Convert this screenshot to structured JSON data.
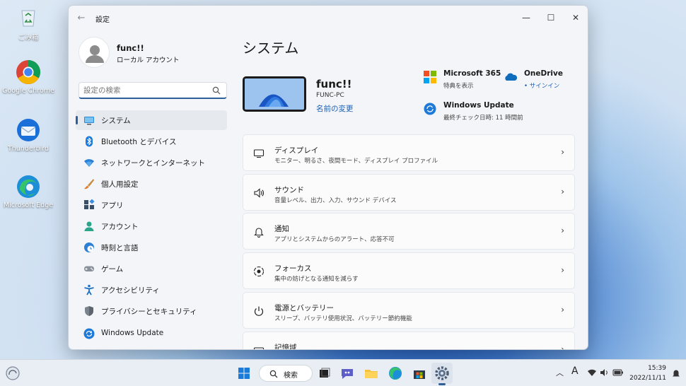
{
  "desktop": {
    "icons": [
      {
        "label": "ごみ箱",
        "icon": "recycle-bin-icon"
      },
      {
        "label": "Google Chrome",
        "icon": "chrome-icon"
      },
      {
        "label": "Thunderbird",
        "icon": "thunderbird-icon"
      },
      {
        "label": "Microsoft Edge",
        "icon": "edge-icon"
      }
    ]
  },
  "window": {
    "title": "設定",
    "controls": {
      "minimize": "—",
      "maximize": "☐",
      "close": "✕"
    }
  },
  "profile": {
    "name": "func!!",
    "account_type": "ローカル アカウント"
  },
  "search": {
    "placeholder": "設定の検索",
    "value": ""
  },
  "nav": {
    "items": [
      {
        "label": "システム",
        "icon": "monitor-icon",
        "active": true
      },
      {
        "label": "Bluetooth とデバイス",
        "icon": "bluetooth-icon"
      },
      {
        "label": "ネットワークとインターネット",
        "icon": "wifi-icon"
      },
      {
        "label": "個人用設定",
        "icon": "brush-icon"
      },
      {
        "label": "アプリ",
        "icon": "apps-icon"
      },
      {
        "label": "アカウント",
        "icon": "person-icon"
      },
      {
        "label": "時刻と言語",
        "icon": "clock-globe-icon"
      },
      {
        "label": "ゲーム",
        "icon": "gamepad-icon"
      },
      {
        "label": "アクセシビリティ",
        "icon": "accessibility-icon"
      },
      {
        "label": "プライバシーとセキュリティ",
        "icon": "shield-icon"
      },
      {
        "label": "Windows Update",
        "icon": "update-icon"
      }
    ]
  },
  "main": {
    "title": "システム",
    "pc": {
      "name": "func!!",
      "hostname": "FUNC-PC",
      "rename_link": "名前の変更"
    },
    "quick": {
      "m365": {
        "title": "Microsoft 365",
        "sub": "特典を表示"
      },
      "onedrive": {
        "title": "OneDrive",
        "sub": "• サインイン"
      },
      "update": {
        "title": "Windows Update",
        "sub": "最終チェック日時: 11 時間前"
      }
    },
    "cards": [
      {
        "title": "ディスプレイ",
        "sub": "モニター、明るさ、夜間モード、ディスプレイ プロファイル",
        "icon": "display-icon"
      },
      {
        "title": "サウンド",
        "sub": "音量レベル、出力、入力、サウンド デバイス",
        "icon": "speaker-icon"
      },
      {
        "title": "通知",
        "sub": "アプリとシステムからのアラート、応答不可",
        "icon": "bell-icon"
      },
      {
        "title": "フォーカス",
        "sub": "集中の妨げとなる通知を減らす",
        "icon": "focus-icon"
      },
      {
        "title": "電源とバッテリー",
        "sub": "スリープ、バッテリ使用状況、バッテリー節約機能",
        "icon": "power-icon"
      },
      {
        "title": "記憶域",
        "sub": "",
        "icon": "storage-icon"
      }
    ]
  },
  "taskbar": {
    "search_label": "検索",
    "ime": "A",
    "time": "15:39",
    "date": "2022/11/11"
  },
  "colors": {
    "accent": "#2d5f9a",
    "link": "#1a5fb4"
  }
}
